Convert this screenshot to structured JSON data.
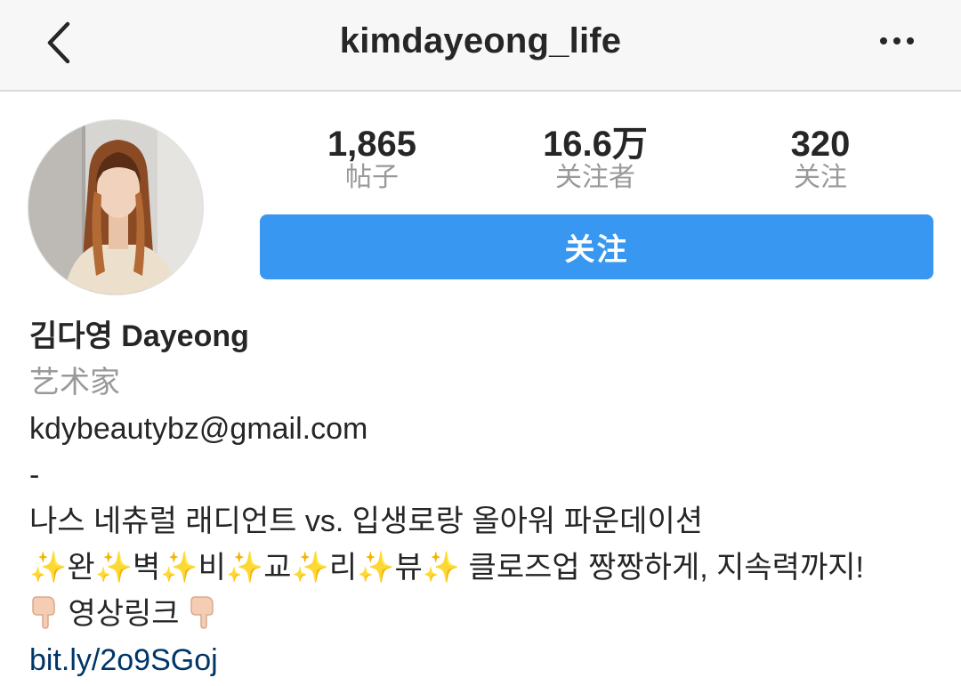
{
  "header": {
    "username": "kimdayeong_life",
    "back_icon": "chevron-left-icon",
    "more_icon": "more-horizontal-icon"
  },
  "stats": {
    "posts": {
      "value": "1,865",
      "label": "帖子"
    },
    "followers": {
      "value": "16.6万",
      "label": "关注者"
    },
    "following": {
      "value": "320",
      "label": "关注"
    }
  },
  "follow_button": {
    "label": "关注"
  },
  "colors": {
    "accent": "#3897f0",
    "link": "#003569",
    "muted_text": "#999999",
    "navbar_bg": "#f7f7f7"
  },
  "bio": {
    "name": "김다영 Dayeong",
    "category": "艺术家",
    "email": "kdybeautybz@gmail.com",
    "separator": "-",
    "line1": "나스 네츄럴 래디언트 vs. 입생로랑 올아워 파운데이션",
    "review_chars": [
      "완",
      "벽",
      "비",
      "교",
      "리",
      "뷰"
    ],
    "line2_tail": "클로즈업 짱짱하게, 지속력까지!",
    "video_link_label": "영상링크",
    "link": "bit.ly/2o9SGoj"
  }
}
